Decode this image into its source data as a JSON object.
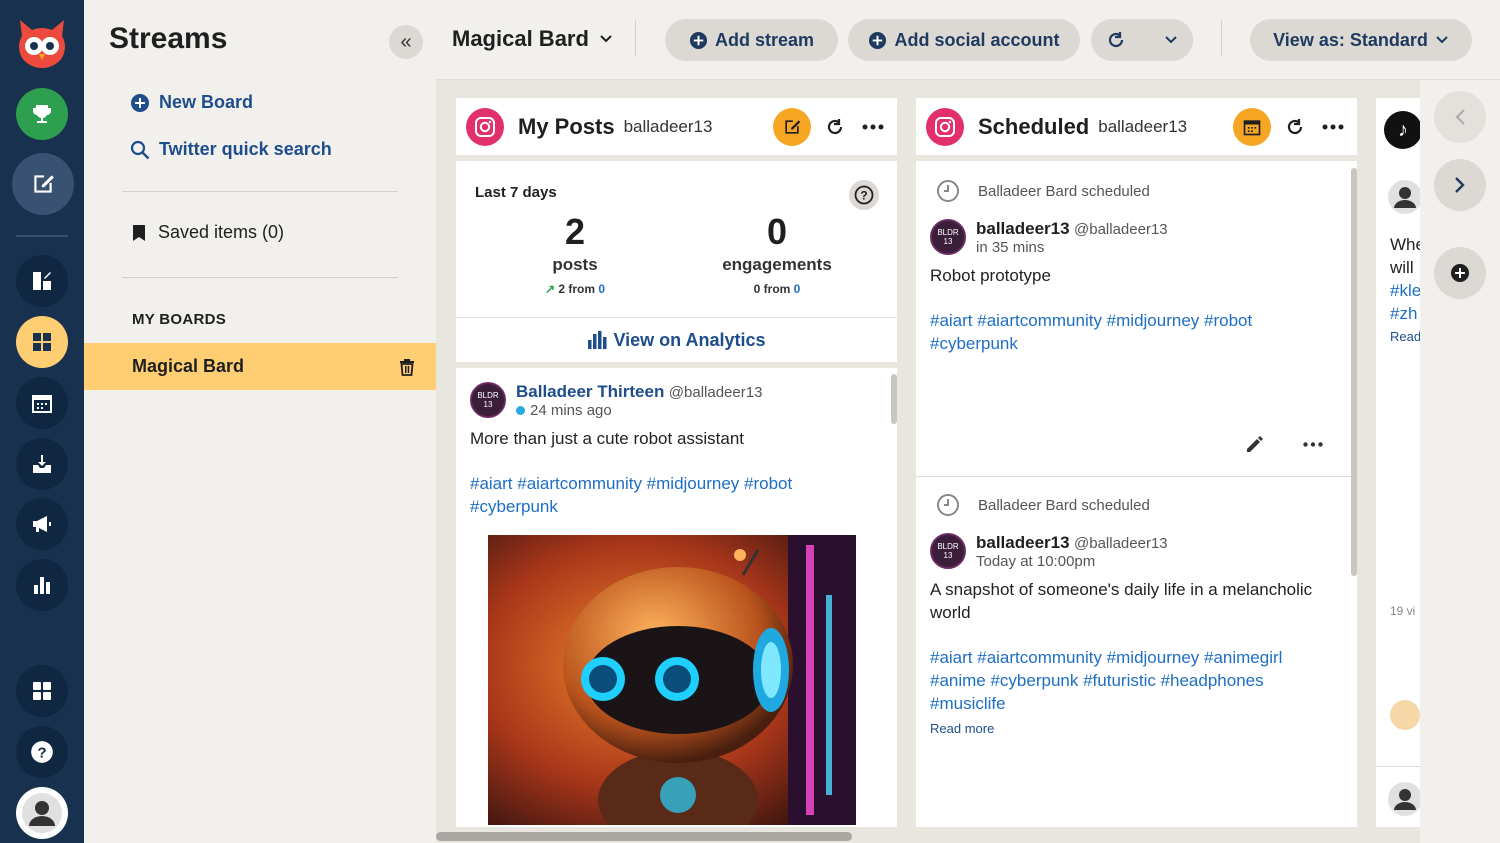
{
  "sidebar": {
    "title": "Streams",
    "new_board": "New Board",
    "twitter_search": "Twitter quick search",
    "saved_items": "Saved items (0)",
    "my_boards_heading": "MY BOARDS",
    "boards": [
      {
        "label": "Magical Bard"
      }
    ]
  },
  "topbar": {
    "board_name": "Magical Bard",
    "add_stream": "Add stream",
    "add_social_account": "Add social account",
    "view_as": "View as: Standard"
  },
  "columns": {
    "my_posts": {
      "title": "My Posts",
      "account": "balladeer13",
      "stats_label": "Last 7 days",
      "posts_value": "2",
      "posts_label": "posts",
      "posts_delta_prefix": "2 from",
      "posts_delta_base": "0",
      "engagements_value": "0",
      "engagements_label": "engagements",
      "engagements_delta_prefix": "0 from",
      "engagements_delta_base": "0",
      "analytics_link": "View on Analytics",
      "post": {
        "avatar_text": "BLDR 13",
        "author": "Balladeer Thirteen",
        "handle": "@balladeer13",
        "time": "24 mins ago",
        "text": "More than just a cute robot assistant",
        "hashtags": "#aiart #aiartcommunity #midjourney #robot #cyberpunk"
      }
    },
    "scheduled": {
      "title": "Scheduled",
      "account": "balladeer13",
      "posts": [
        {
          "status": "Balladeer Bard scheduled",
          "avatar_text": "BLDR 13",
          "author": "balladeer13",
          "handle": "@balladeer13",
          "time": "in 35 mins",
          "text": "Robot prototype",
          "hashtags": "#aiart #aiartcommunity #midjourney #robot #cyberpunk"
        },
        {
          "status": "Balladeer Bard scheduled",
          "avatar_text": "BLDR 13",
          "author": "balladeer13",
          "handle": "@balladeer13",
          "time": "Today at 10:00pm",
          "text": "A snapshot of someone's daily life in a melancholic world",
          "hashtags": "#aiart #aiartcommunity #midjourney #animegirl #anime #cyberpunk #futuristic #headphones #musiclife",
          "read_more": "Read more"
        }
      ]
    },
    "tiktok": {
      "lines": [
        "Whe",
        "will",
        "#kle",
        "#zh"
      ],
      "read": "Read",
      "views": "19 vi"
    }
  },
  "colors": {
    "accent_yellow": "#ffce73",
    "brand_orange": "#f5a623",
    "link_blue": "#1e4d8c",
    "rail": "#18314f"
  }
}
